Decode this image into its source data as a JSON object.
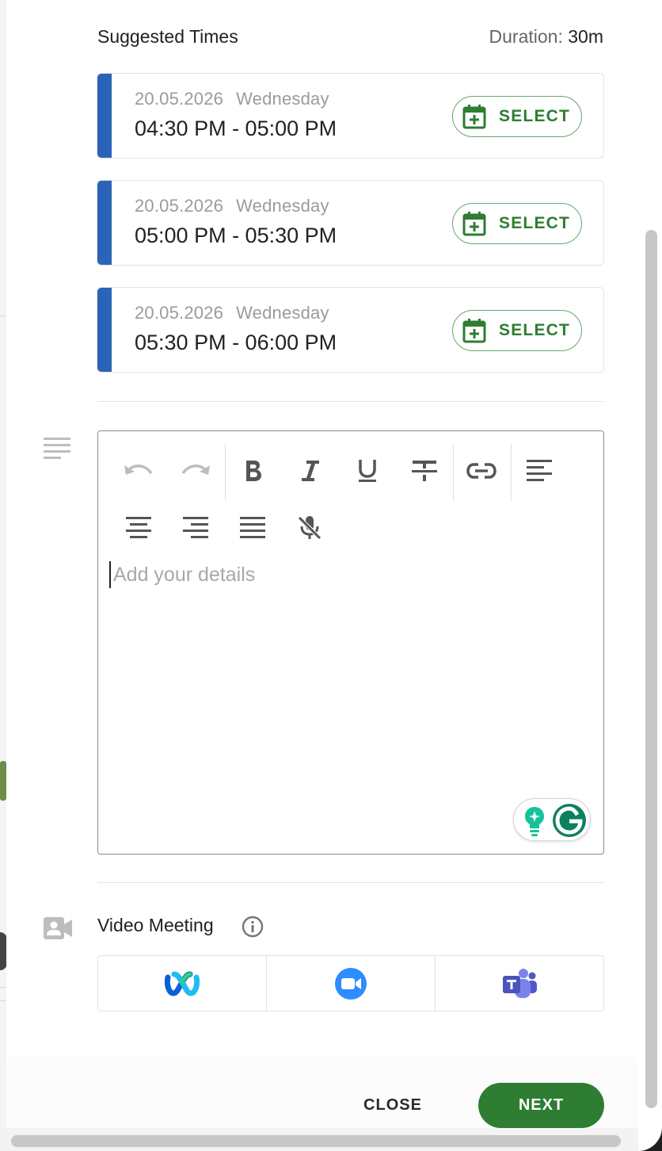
{
  "suggested": {
    "title": "Suggested Times",
    "duration_label": "Duration:",
    "duration_value": "30m",
    "slots": [
      {
        "date": "20.05.2026",
        "weekday": "Wednesday",
        "time": "04:30 PM - 05:00 PM",
        "action": "SELECT"
      },
      {
        "date": "20.05.2026",
        "weekday": "Wednesday",
        "time": "05:00 PM - 05:30 PM",
        "action": "SELECT"
      },
      {
        "date": "20.05.2026",
        "weekday": "Wednesday",
        "time": "05:30 PM - 06:00 PM",
        "action": "SELECT"
      }
    ]
  },
  "editor": {
    "placeholder": "Add your details",
    "toolbar": [
      "undo",
      "redo",
      "bold",
      "italic",
      "underline",
      "strikethrough",
      "link",
      "align-left",
      "align-center",
      "align-right",
      "justify",
      "mic-off"
    ]
  },
  "video": {
    "label": "Video Meeting",
    "options": [
      "webex",
      "zoom",
      "teams"
    ]
  },
  "footer": {
    "close_label": "CLOSE",
    "next_label": "NEXT"
  },
  "colors": {
    "accent_green": "#2e7d32",
    "slot_bar_blue": "#2a63b8",
    "zoom_blue": "#2d8cff",
    "teams_purple": "#5b5fc7"
  }
}
